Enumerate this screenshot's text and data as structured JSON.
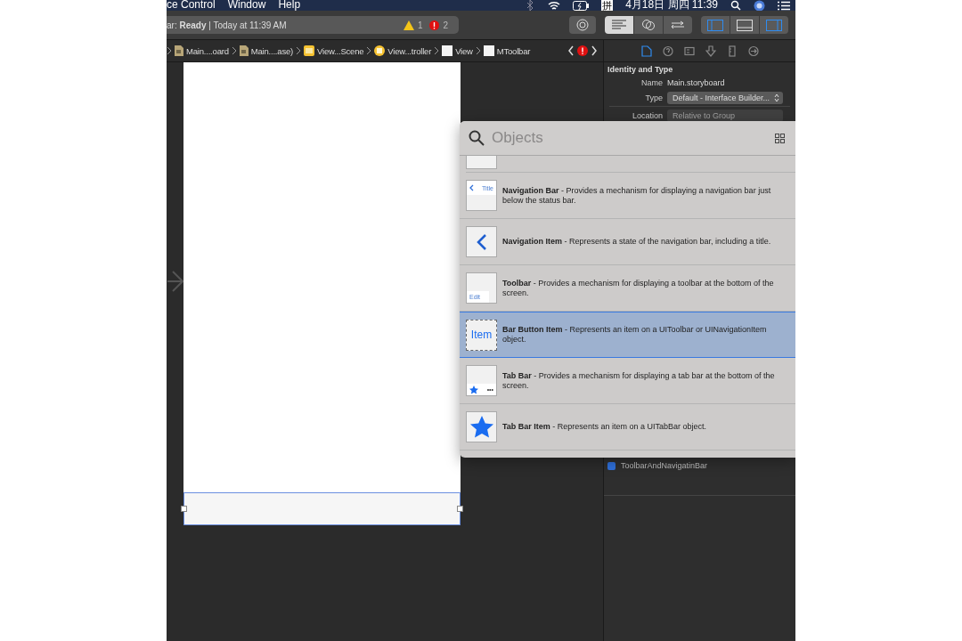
{
  "menu_bar": {
    "items": [
      "ce Control",
      "Window",
      "Help"
    ],
    "clock": "4月18日 周四 11:39",
    "input_method": "拼"
  },
  "toolbar": {
    "status": "ar: **Ready** | Today at 11:39 AM",
    "warnings": "1",
    "errors": "2",
    "editor_modes": [
      {
        "kind": "standard",
        "selected": true
      },
      {
        "kind": "assistant",
        "selected": false
      },
      {
        "kind": "version",
        "selected": false
      }
    ],
    "panels": [
      {
        "kind": "navigator",
        "on": true
      },
      {
        "kind": "debug",
        "on": false
      },
      {
        "kind": "inspector",
        "on": true
      }
    ]
  },
  "breadcrumbs": [
    {
      "label": "Main....oard",
      "kind": "file"
    },
    {
      "label": "Main....ase)",
      "kind": "file"
    },
    {
      "label": "View...Scene",
      "kind": "scene"
    },
    {
      "label": "View...troller",
      "kind": "controller"
    },
    {
      "label": "View",
      "kind": "view"
    },
    {
      "label": "MToolbar",
      "kind": "view"
    }
  ],
  "inspector": {
    "tabs": [
      {
        "kind": "file",
        "selected": true
      },
      {
        "kind": "help",
        "selected": false
      },
      {
        "kind": "identity",
        "selected": false
      },
      {
        "kind": "attributes",
        "selected": false
      },
      {
        "kind": "size",
        "selected": false
      },
      {
        "kind": "connections",
        "selected": false
      }
    ],
    "section": "Identity and Type",
    "name_label": "Name",
    "name": "Main.storyboard",
    "type_label": "Type",
    "type": "Default - Interface Builder...",
    "location_label": "Location",
    "location": "Relative to Group",
    "outline_item": "ToolbarAndNavigatinBar"
  },
  "library": {
    "placeholder": "Objects",
    "items": [
      {
        "kind": "navbar",
        "title": "Navigation Bar",
        "description": "- Provides a mechanism for displaying a navigation bar just below the status bar.",
        "thumb_text": "Title",
        "selected": false
      },
      {
        "kind": "navitem",
        "title": "Navigation Item",
        "description": "- Represents a state of the navigation bar, including a title.",
        "selected": false
      },
      {
        "kind": "toolbar",
        "title": "Toolbar",
        "description": "- Provides a mechanism for displaying a toolbar at the bottom of the screen.",
        "thumb_text": "Edit",
        "selected": false
      },
      {
        "kind": "barbutton",
        "title": "Bar Button Item",
        "description": "- Represents an item on a UIToolbar or UINavigationItem object.",
        "thumb_text": "Item",
        "selected": true
      },
      {
        "kind": "tabbar",
        "title": "Tab Bar",
        "description": "- Provides a mechanism for displaying a tab bar at the bottom of the screen.",
        "thumb_text": "•••",
        "selected": false
      },
      {
        "kind": "tabbaritem",
        "title": "Tab Bar Item",
        "description": "- Represents an item on a UITabBar object.",
        "selected": false
      }
    ]
  }
}
